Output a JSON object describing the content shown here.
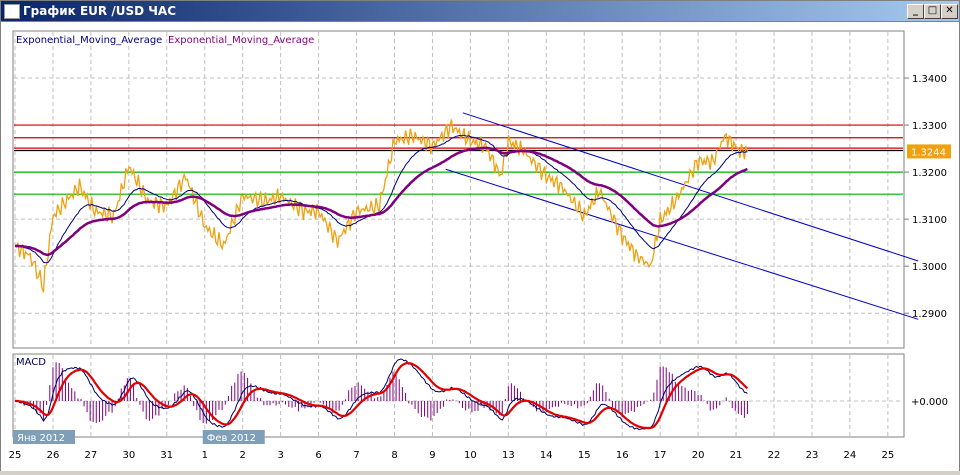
{
  "window": {
    "title": "График EUR /USD  ЧАС",
    "minimize": "_",
    "maximize": "□",
    "close": "✕"
  },
  "legend": {
    "ema_fast": "Exponential_Moving_Average",
    "ema_slow": "Exponential_Moving_Average",
    "ema_fast_color": "#00007f",
    "ema_slow_color": "#7f007f"
  },
  "macd": {
    "label": "MACD",
    "zero_label": "+0.000"
  },
  "colors": {
    "price": "#f0a010",
    "resistance": "#d00000",
    "support": "#00b000",
    "channel": "#0000c0",
    "current": "#000000",
    "badge_bg": "#f0a010",
    "macd_line": "#00005f",
    "signal_line": "#e00000",
    "histogram": "#7f007f"
  },
  "chart_data": {
    "type": "line",
    "title": "",
    "ylim": [
      1.2826,
      1.35
    ],
    "y_ticks": [
      "1.3400",
      "1.3300",
      "1.3200",
      "1.3100",
      "1.3000",
      "1.2900"
    ],
    "y_tick_values": [
      1.34,
      1.33,
      1.32,
      1.31,
      1.3,
      1.29
    ],
    "current_price": "1.3244",
    "x_labels": [
      "25",
      "26",
      "27",
      "30",
      "31",
      "1",
      "2",
      "3",
      "6",
      "7",
      "8",
      "9",
      "10",
      "13",
      "14",
      "15",
      "16",
      "17",
      "20",
      "21",
      "22",
      "23",
      "24",
      "25"
    ],
    "month_labels": [
      {
        "label": "Янв 2012",
        "at": "25"
      },
      {
        "label": "Фев 2012",
        "at": "1"
      }
    ],
    "grid": true,
    "price_series": [
      [
        0,
        1.3043
      ],
      [
        0.4,
        1.3021
      ],
      [
        0.75,
        1.2957
      ],
      [
        1,
        1.3106
      ],
      [
        1.7,
        1.317
      ],
      [
        2.1,
        1.3117
      ],
      [
        2.6,
        1.3106
      ],
      [
        3,
        1.3213
      ],
      [
        3.5,
        1.3138
      ],
      [
        4,
        1.3128
      ],
      [
        4.5,
        1.3191
      ],
      [
        5,
        1.3085
      ],
      [
        5.5,
        1.3043
      ],
      [
        6,
        1.3149
      ],
      [
        6.6,
        1.3138
      ],
      [
        7,
        1.3149
      ],
      [
        7.6,
        1.3117
      ],
      [
        8,
        1.3117
      ],
      [
        8.5,
        1.3053
      ],
      [
        9,
        1.3117
      ],
      [
        9.6,
        1.3128
      ],
      [
        10,
        1.3266
      ],
      [
        10.5,
        1.3277
      ],
      [
        11,
        1.3255
      ],
      [
        11.5,
        1.3298
      ],
      [
        12,
        1.3266
      ],
      [
        12.4,
        1.3255
      ],
      [
        12.8,
        1.3191
      ],
      [
        13,
        1.3266
      ],
      [
        13.4,
        1.3245
      ],
      [
        14,
        1.3191
      ],
      [
        14.4,
        1.317
      ],
      [
        15,
        1.3106
      ],
      [
        15.4,
        1.316
      ],
      [
        16,
        1.3064
      ],
      [
        16.4,
        1.3021
      ],
      [
        16.75,
        1.3
      ],
      [
        17,
        1.3096
      ],
      [
        17.4,
        1.3138
      ],
      [
        18,
        1.3223
      ],
      [
        18.4,
        1.3223
      ],
      [
        18.7,
        1.3277
      ],
      [
        19.1,
        1.3245
      ],
      [
        19.3,
        1.3244
      ]
    ],
    "horizontal_lines": [
      {
        "price": 1.33,
        "kind": "resistance"
      },
      {
        "price": 1.3273,
        "kind": "resistance"
      },
      {
        "price": 1.3251,
        "kind": "resistance"
      },
      {
        "price": 1.3246,
        "kind": "current"
      },
      {
        "price": 1.32,
        "kind": "support"
      },
      {
        "price": 1.3153,
        "kind": "support"
      }
    ],
    "channel_lines": [
      {
        "from": [
          11.8,
          1.3326
        ],
        "to": [
          23.8,
          1.3011
        ]
      },
      {
        "from": [
          11.35,
          1.3206
        ],
        "to": [
          23.8,
          1.2887
        ]
      }
    ]
  }
}
